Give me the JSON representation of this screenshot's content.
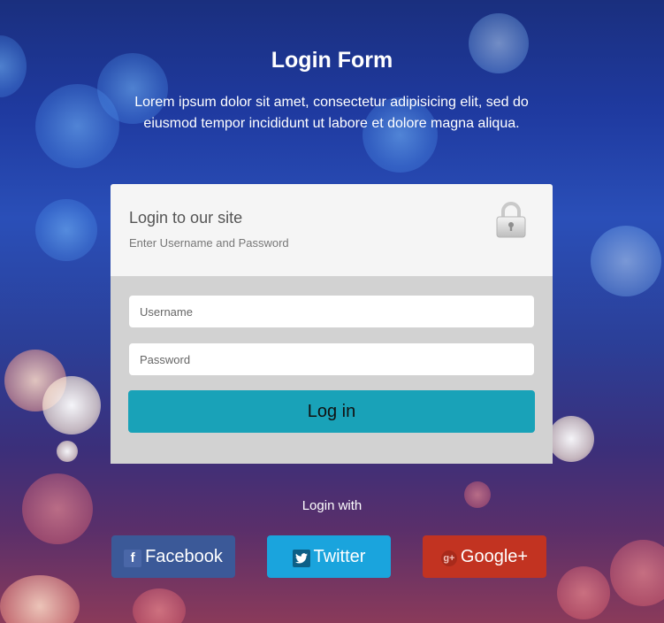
{
  "header": {
    "title": "Login Form",
    "description": "Lorem ipsum dolor sit amet, consectetur adipisicing elit, sed do eiusmod tempor incididunt ut labore et dolore magna aliqua."
  },
  "card": {
    "heading": "Login to our site",
    "subheading": "Enter Username and Password",
    "lock_icon": "lock-icon",
    "username": {
      "placeholder": "Username",
      "value": ""
    },
    "password": {
      "placeholder": "Password",
      "value": ""
    },
    "login_label": "Log in"
  },
  "social": {
    "caption": "Login with",
    "buttons": [
      {
        "label": "Facebook",
        "icon": "facebook-icon",
        "color": "#3b5998"
      },
      {
        "label": "Twitter",
        "icon": "twitter-icon",
        "color": "#1aa4dd"
      },
      {
        "label": "Google+",
        "icon": "google-plus-icon",
        "color": "#c23321"
      }
    ]
  },
  "colors": {
    "login_button": "#19a2b8",
    "card_top": "#f5f5f5",
    "card_bottom": "#d2d2d2"
  }
}
